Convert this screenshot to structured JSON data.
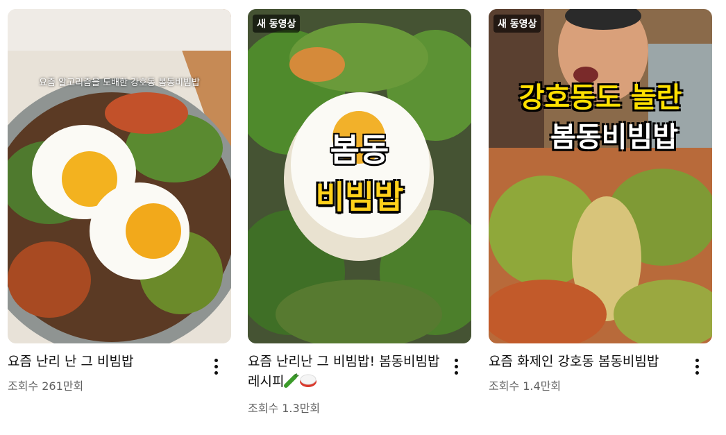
{
  "videos": [
    {
      "title": "요즘 난리 난 그 비빔밥",
      "views": "조회수 261만회",
      "thumb_caption": "요즘 알고리즘을 도배한 강호동 봄동비빔밥"
    },
    {
      "badge": "새 동영상",
      "title": "요즘 난리난 그 비빔밥! 봄동비빔밥 레시피",
      "views": "조회수 1.3만회",
      "thumb_line1": "봄동",
      "thumb_line2": "비빔밥",
      "title_emojis": [
        "cucumber-icon",
        "rice-cake-icon"
      ]
    },
    {
      "badge": "새 동영상",
      "title": "요즘 화제인 강호동 봄동비빔밥",
      "views": "조회수 1.4만회",
      "thumb_line1": "강호동도 놀란",
      "thumb_line2": "봄동비빔밥"
    }
  ],
  "colors": {
    "views_text": "#606060",
    "overlay_yellow": "#ffd11a",
    "overlay_yellow_3": "#ffe000"
  }
}
